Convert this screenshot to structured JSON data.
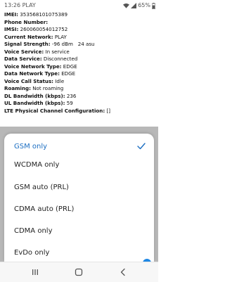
{
  "status_bar": {
    "time": "13:26",
    "carrier": "PLAY",
    "battery": "65%",
    "icons": [
      "wifi-icon",
      "signal-icon",
      "battery-icon"
    ]
  },
  "phone_info": {
    "rows": [
      {
        "label": "IMEI:",
        "value": "353568101075389"
      },
      {
        "label": "Phone Number:",
        "value": ""
      },
      {
        "label": "IMSI:",
        "value": "260060054012752"
      },
      {
        "label": "Current Network:",
        "value": "PLAY"
      },
      {
        "label": "Signal Strength:",
        "value": "-96 dBm   24 asu"
      },
      {
        "label": "Voice Service:",
        "value": "In service"
      },
      {
        "label": "Data Service:",
        "value": "Disconnected"
      },
      {
        "label": "Voice Network Type:",
        "value": "EDGE"
      },
      {
        "label": "Data Network Type:",
        "value": "EDGE"
      },
      {
        "label": "Voice Call Status:",
        "value": "Idle"
      },
      {
        "label": "Roaming:",
        "value": "Not roaming"
      },
      {
        "label": "DL Bandwidth (kbps):",
        "value": "236"
      },
      {
        "label": "UL Bandwidth (kbps):",
        "value": "59"
      },
      {
        "label": "LTE Physical Channel Configuration:",
        "value": "[]"
      }
    ]
  },
  "network_type_menu": {
    "options": [
      {
        "label": "GSM only",
        "selected": true
      },
      {
        "label": "WCDMA only",
        "selected": false
      },
      {
        "label": "GSM auto (PRL)",
        "selected": false
      },
      {
        "label": "CDMA auto (PRL)",
        "selected": false
      },
      {
        "label": "CDMA only",
        "selected": false
      },
      {
        "label": "EvDo only",
        "selected": false
      }
    ]
  },
  "nav_bar": {
    "buttons": [
      "recents-icon",
      "home-icon",
      "back-icon"
    ]
  },
  "colors": {
    "accent": "#1b6ec2",
    "scrim": "rgba(0,0,0,0.28)"
  }
}
